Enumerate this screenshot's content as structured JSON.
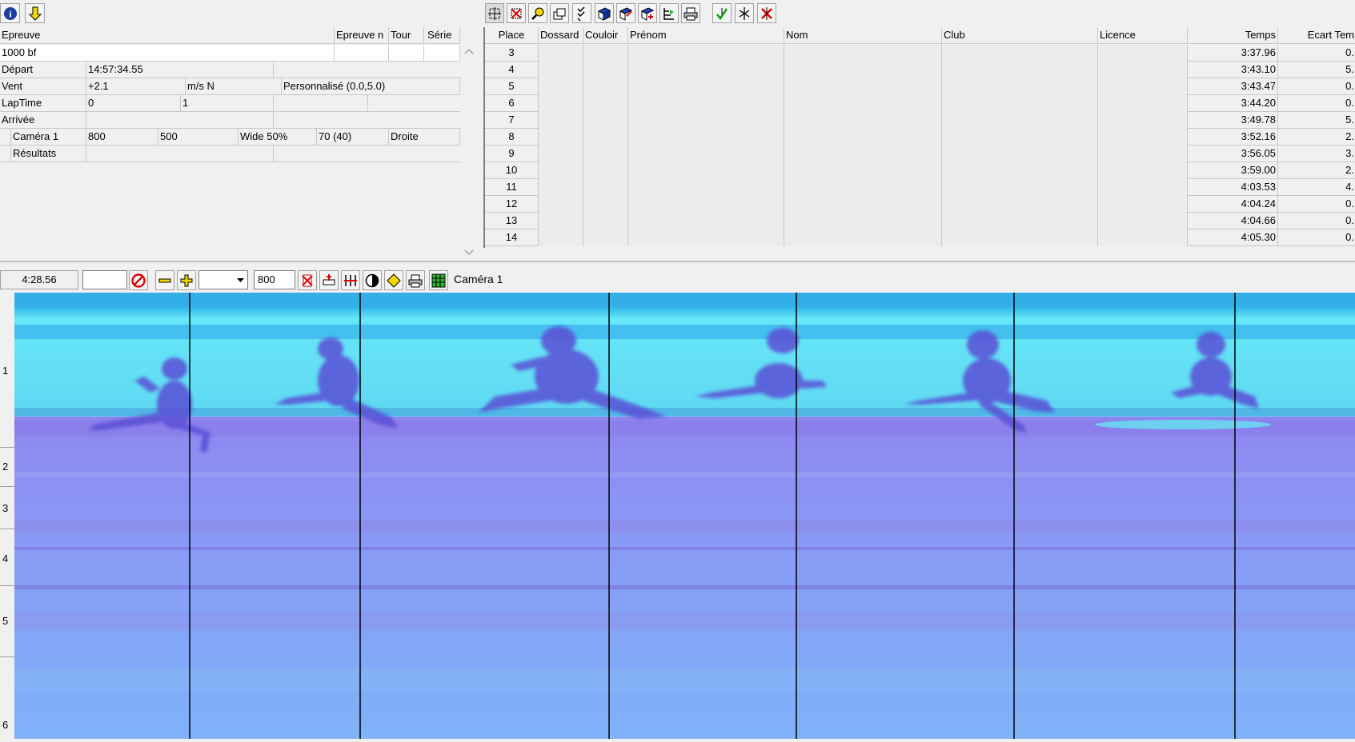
{
  "toolbar_left": {
    "icons": [
      "info-icon",
      "down-arrow-icon"
    ]
  },
  "toolbar_right": {
    "icons": [
      "zoom-grid-icon",
      "close-red-icon",
      "magnifier-icon",
      "windows-icon",
      "check-list-icon",
      "book-icon",
      "book-edit-icon",
      "book-add-icon",
      "tree-icon",
      "printer-icon",
      "green-check-icon",
      "split-icon",
      "red-x-icon"
    ]
  },
  "event_grid": {
    "headers": [
      "Epreuve",
      "Epreuve n",
      "Tour",
      "Série"
    ],
    "event_name": "1000 bf",
    "rows": [
      {
        "label": "Départ",
        "v1": "14:57:34.55",
        "v2": "",
        "v3": "",
        "v4": ""
      },
      {
        "label": "Vent",
        "v1": "+2.1",
        "v2": "m/s N",
        "v3": "Personnalisé (0.0,5.0)",
        "v4": ""
      },
      {
        "label": "LapTime",
        "v1": "0",
        "v2": "1",
        "v3": "",
        "v4": ""
      },
      {
        "label": "Arrivée",
        "v1": "",
        "v2": "",
        "v3": "",
        "v4": ""
      }
    ],
    "camera": {
      "label": "Caméra 1",
      "v1": "800",
      "v2": "500",
      "v3": "Wide 50%",
      "v4": "70  (40)",
      "v5": "Droite"
    },
    "results_label": "Résultats"
  },
  "results_grid": {
    "headers": [
      "Place",
      "Dossard",
      "Couloir",
      "Prénom",
      "Nom",
      "Club",
      "Licence",
      "Temps",
      "Ecart Tem"
    ],
    "rows": [
      {
        "place": "3",
        "temps": "3:37.96",
        "ecart": "0."
      },
      {
        "place": "4",
        "temps": "3:43.10",
        "ecart": "5."
      },
      {
        "place": "5",
        "temps": "3:43.47",
        "ecart": "0."
      },
      {
        "place": "6",
        "temps": "3:44.20",
        "ecart": "0."
      },
      {
        "place": "7",
        "temps": "3:49.78",
        "ecart": "5."
      },
      {
        "place": "8",
        "temps": "3:52.16",
        "ecart": "2."
      },
      {
        "place": "9",
        "temps": "3:56.05",
        "ecart": "3."
      },
      {
        "place": "10",
        "temps": "3:59.00",
        "ecart": "2."
      },
      {
        "place": "11",
        "temps": "4:03.53",
        "ecart": "4."
      },
      {
        "place": "12",
        "temps": "4:04.24",
        "ecart": "0."
      },
      {
        "place": "13",
        "temps": "4:04.66",
        "ecart": "0."
      },
      {
        "place": "14",
        "temps": "4:05.30",
        "ecart": "0."
      }
    ]
  },
  "image_toolbar": {
    "time": "4:28.56",
    "field2": "",
    "select_value": "",
    "width_value": "800",
    "camera_label": "Caméra 1"
  },
  "lanes": [
    "1",
    "2",
    "3",
    "4",
    "5",
    "6"
  ],
  "colors": {
    "track": "#8a90f0",
    "sky": "#5ee0f5",
    "line": "#000000"
  }
}
